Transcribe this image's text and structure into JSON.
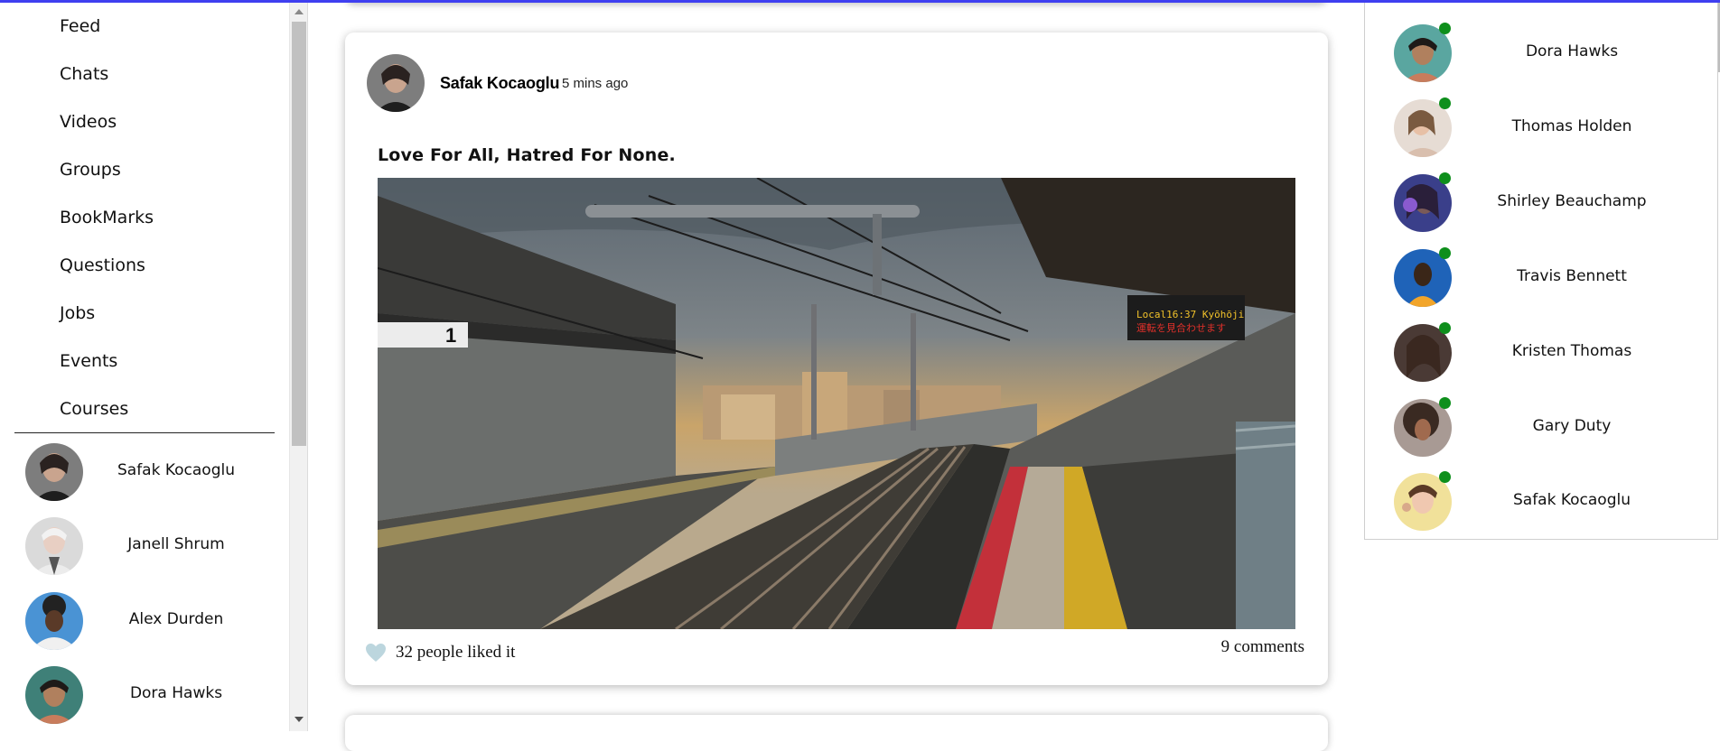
{
  "sidebar": {
    "nav": [
      "Feed",
      "Chats",
      "Videos",
      "Groups",
      "BookMarks",
      "Questions",
      "Jobs",
      "Events",
      "Courses"
    ],
    "users": [
      {
        "name": "Safak Kocaoglu",
        "avatar_color": "#8a8a8a"
      },
      {
        "name": "Janell Shrum",
        "avatar_color": "#d8d8d8"
      },
      {
        "name": "Alex Durden",
        "avatar_color": "#4a8fd0"
      },
      {
        "name": "Dora Hawks",
        "avatar_color": "#3e7a72"
      }
    ]
  },
  "post": {
    "author": "Safak Kocaoglu",
    "time": "5 mins ago",
    "text": "Love For All, Hatred For None.",
    "likes_label": "32 people liked it",
    "comments_label": "9 comments",
    "heart_color": "#bcd6de"
  },
  "online_friends": [
    {
      "name": "Dora Hawks",
      "avatar_color": "#5aa6a0"
    },
    {
      "name": "Thomas Holden",
      "avatar_color": "#e6dcd4"
    },
    {
      "name": "Shirley Beauchamp",
      "avatar_color": "#4b3f8f"
    },
    {
      "name": "Travis Bennett",
      "avatar_color": "#1f63b8"
    },
    {
      "name": "Kristen Thomas",
      "avatar_color": "#4a3a35"
    },
    {
      "name": "Gary Duty",
      "avatar_color": "#6a564e"
    },
    {
      "name": "Safak Kocaoglu",
      "avatar_color": "#f1e19a"
    }
  ],
  "colors": {
    "online": "#0e8f1c",
    "accent_top": "#3f3ff0"
  }
}
